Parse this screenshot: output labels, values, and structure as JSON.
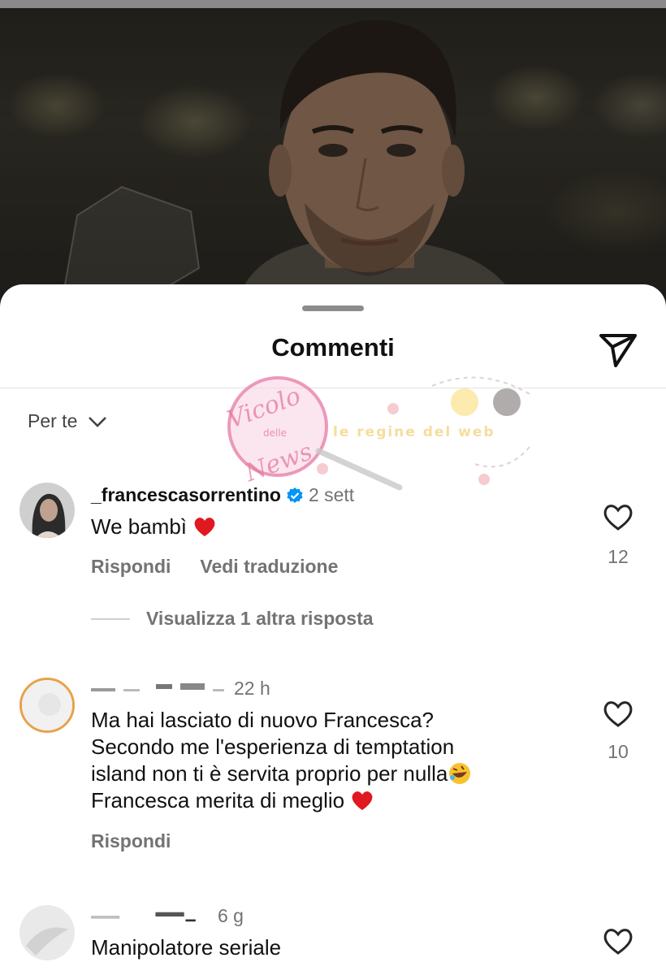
{
  "sheet": {
    "title": "Commenti",
    "filter_label": "Per te"
  },
  "watermark": {
    "brand_line1": "Vicolo",
    "brand_line2": "delle",
    "brand_line3": "News",
    "tagline": "le regine del web"
  },
  "comments": [
    {
      "username": "_francescasorrentino",
      "verified": true,
      "time": "2 sett",
      "text": "We bambì",
      "likes": "12",
      "actions": [
        "Rispondi",
        "Vedi traduzione"
      ],
      "view_replies": "Visualizza 1 altra risposta"
    },
    {
      "username_partial": "...",
      "time": "22 h",
      "text_lines": [
        "Ma hai lasciato di nuovo Francesca?",
        "Secondo me l'esperienza di temptation",
        "island non ti è servita proprio per nulla",
        "Francesca merita di meglio"
      ],
      "likes": "10",
      "actions": [
        "Rispondi"
      ]
    },
    {
      "username_partial": "...n_",
      "time": "6 g",
      "text": "Manipolatore seriale",
      "likes": ""
    }
  ],
  "icons": {
    "share": "paper-plane-icon",
    "like": "heart-outline-icon",
    "filter": "chevron-down-icon",
    "verified": "verified-badge-icon"
  },
  "colors": {
    "verified_blue": "#0095f6",
    "heart_red": "#e0181f",
    "secondary_text": "#737373"
  }
}
